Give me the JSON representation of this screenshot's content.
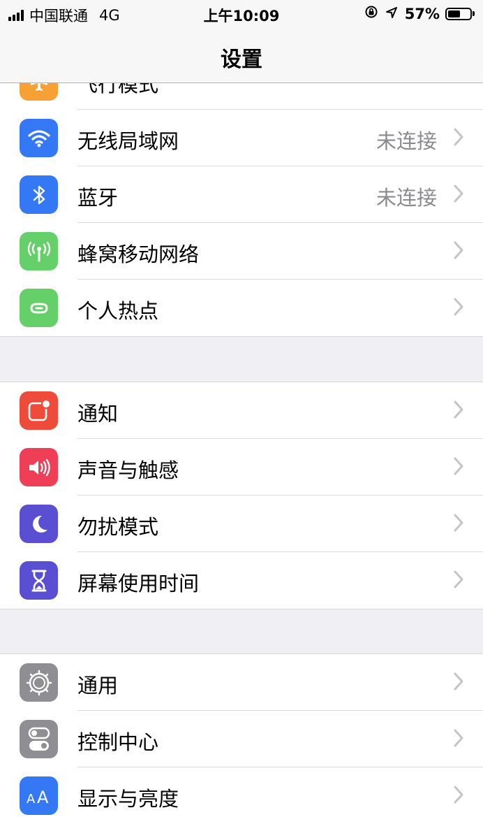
{
  "statusbar": {
    "carrier": "中国联通",
    "network": "4G",
    "time": "上午10:09",
    "battery": "57%",
    "battery_level": 0.57
  },
  "navbar": {
    "title": "设置"
  },
  "groups": [
    {
      "rows": [
        {
          "label": "飞行模式",
          "value": "",
          "icon": "airplane-icon",
          "color": "#f7a033",
          "toggle": false
        },
        {
          "label": "无线局域网",
          "value": "未连接",
          "icon": "wifi-icon",
          "color": "#3478f6"
        },
        {
          "label": "蓝牙",
          "value": "未连接",
          "icon": "bluetooth-icon",
          "color": "#3478f6"
        },
        {
          "label": "蜂窝移动网络",
          "value": "",
          "icon": "cellular-icon",
          "color": "#65d06a"
        },
        {
          "label": "个人热点",
          "value": "",
          "icon": "hotspot-icon",
          "color": "#65d06a"
        }
      ]
    },
    {
      "rows": [
        {
          "label": "通知",
          "value": "",
          "icon": "notification-icon",
          "color": "#ee4b3a"
        },
        {
          "label": "声音与触感",
          "value": "",
          "icon": "speaker-icon",
          "color": "#ee3f57"
        },
        {
          "label": "勿扰模式",
          "value": "",
          "icon": "moon-icon",
          "color": "#5a4fd3"
        },
        {
          "label": "屏幕使用时间",
          "value": "",
          "icon": "hourglass-icon",
          "color": "#5a4fd3"
        }
      ]
    },
    {
      "rows": [
        {
          "label": "通用",
          "value": "",
          "icon": "gear-icon",
          "color": "#8e8e93"
        },
        {
          "label": "控制中心",
          "value": "",
          "icon": "switches-icon",
          "color": "#8e8e93"
        },
        {
          "label": "显示与亮度",
          "value": "",
          "icon": "text-size-icon",
          "color": "#3478f6"
        }
      ]
    }
  ]
}
